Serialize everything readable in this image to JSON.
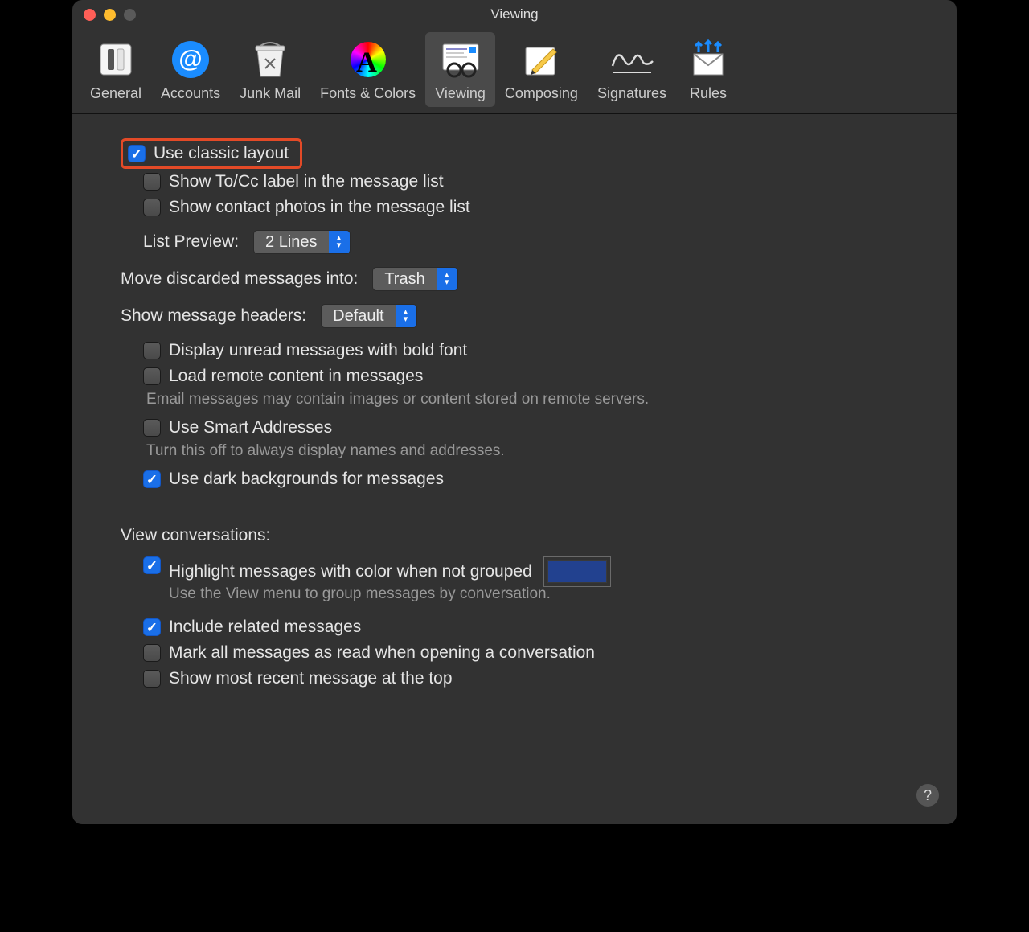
{
  "window_title": "Viewing",
  "toolbar": [
    {
      "label": "General"
    },
    {
      "label": "Accounts"
    },
    {
      "label": "Junk Mail"
    },
    {
      "label": "Fonts & Colors"
    },
    {
      "label": "Viewing"
    },
    {
      "label": "Composing"
    },
    {
      "label": "Signatures"
    },
    {
      "label": "Rules"
    }
  ],
  "options": {
    "classic_layout": "Use classic layout",
    "show_to_cc": "Show To/Cc label in the message list",
    "show_contact_photos": "Show contact photos in the message list",
    "list_preview_label": "List Preview:",
    "list_preview_value": "2 Lines",
    "discarded_label": "Move discarded messages into:",
    "discarded_value": "Trash",
    "headers_label": "Show message headers:",
    "headers_value": "Default",
    "bold_unread": "Display unread messages with bold font",
    "load_remote": "Load remote content in messages",
    "load_remote_desc": "Email messages may contain images or content stored on remote servers.",
    "smart_addr": "Use Smart Addresses",
    "smart_addr_desc": "Turn this off to always display names and addresses.",
    "dark_bg": "Use dark backgrounds for messages",
    "view_conv": "View conversations:",
    "highlight_color": "Highlight messages with color when not grouped",
    "highlight_color_desc": "Use the View menu to group messages by conversation.",
    "include_related": "Include related messages",
    "mark_read": "Mark all messages as read when opening a conversation",
    "recent_top": "Show most recent message at the top"
  },
  "highlight_chip_color": "#22418f",
  "help_glyph": "?"
}
